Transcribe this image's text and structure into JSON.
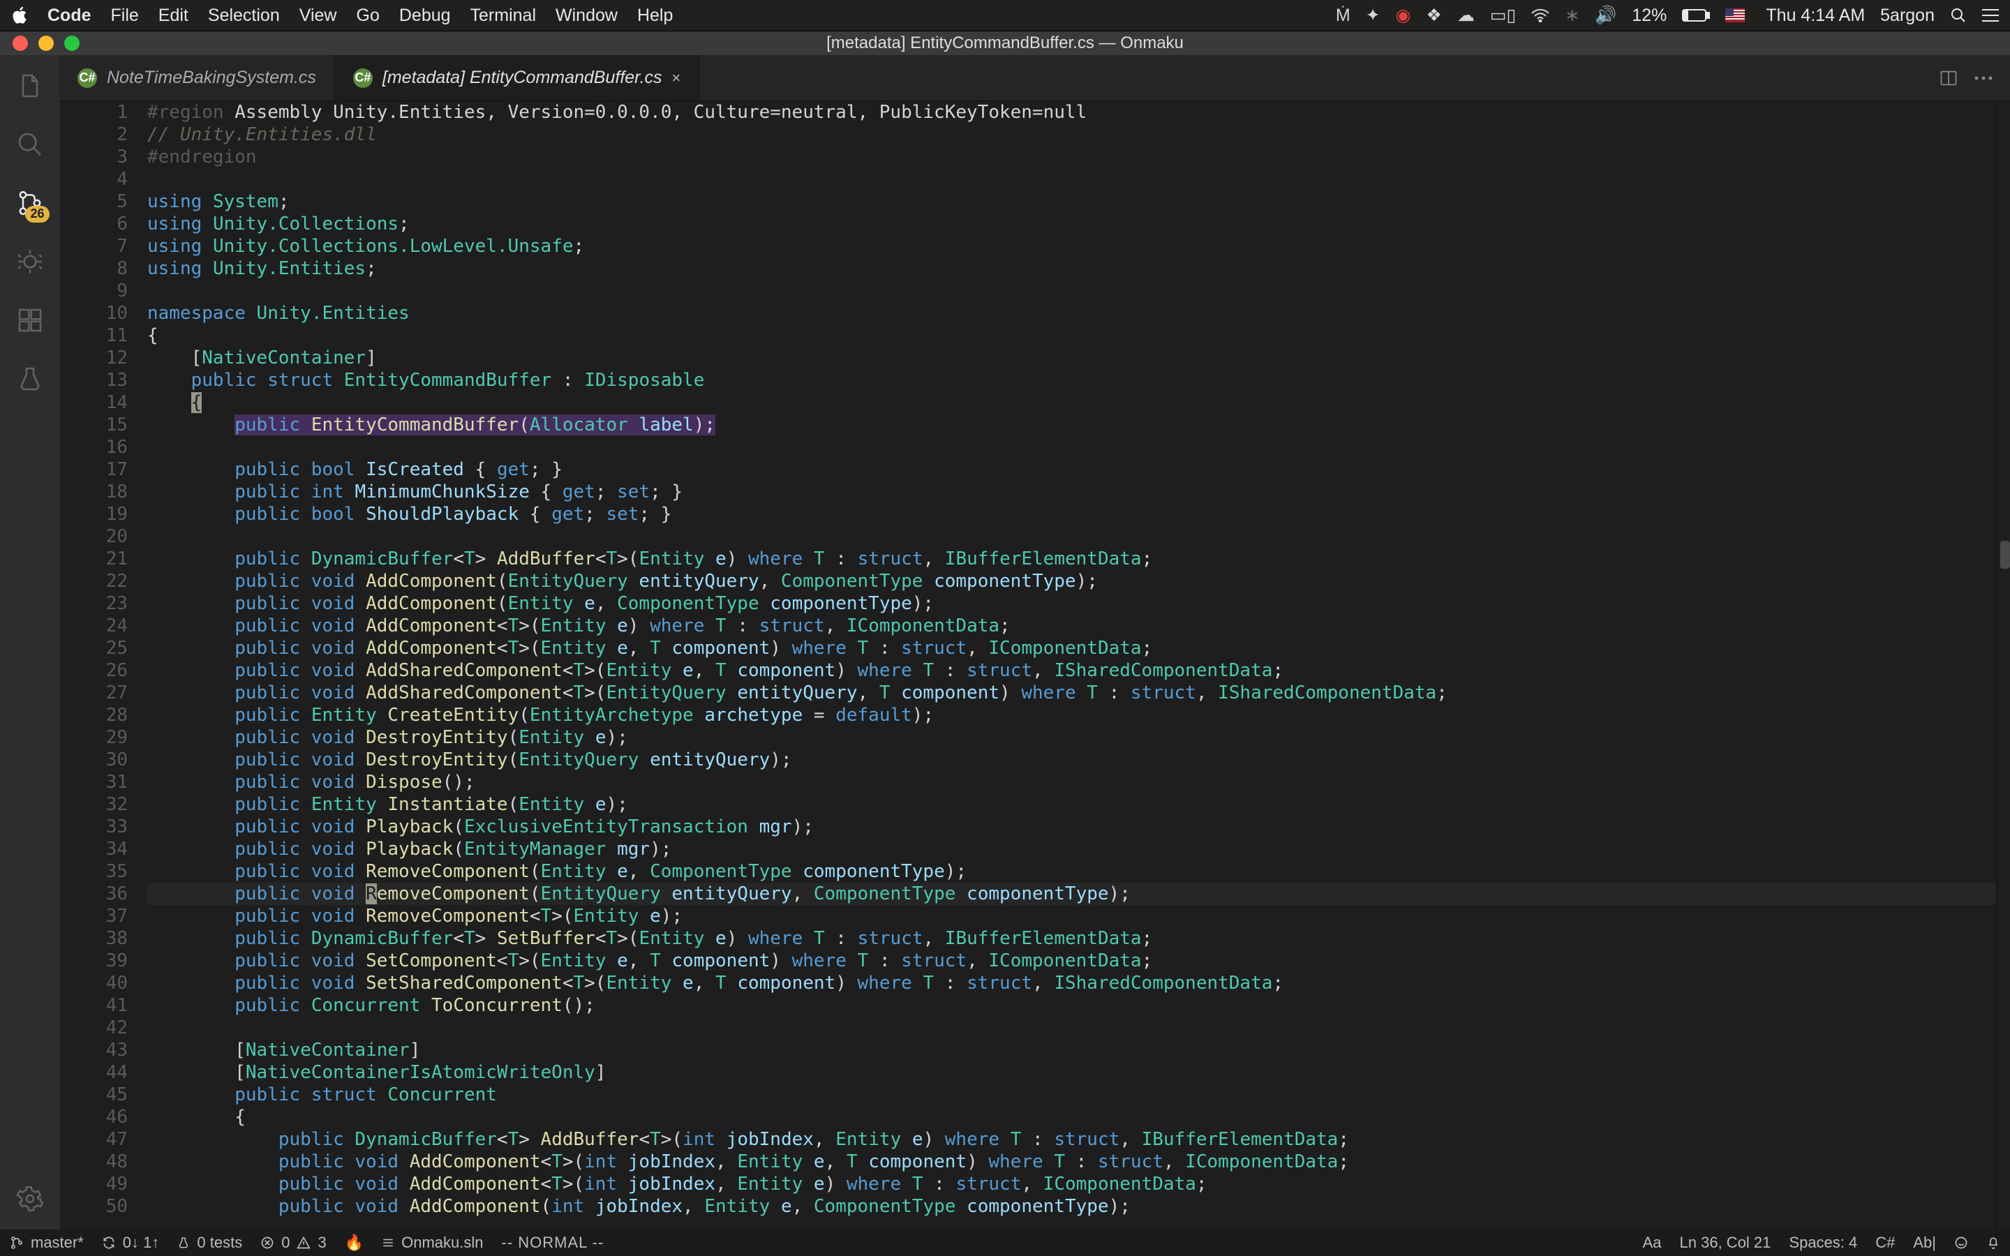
{
  "menubar": {
    "app_name": "Code",
    "items": [
      "File",
      "Edit",
      "Selection",
      "View",
      "Go",
      "Debug",
      "Terminal",
      "Window",
      "Help"
    ],
    "battery_pct": "12%",
    "clock": "Thu 4:14 AM",
    "user": "5argon"
  },
  "window": {
    "title": "[metadata] EntityCommandBuffer.cs — Onmaku"
  },
  "activitybar": {
    "badge": "26"
  },
  "tabs": [
    {
      "icon": "C#",
      "label": "NoteTimeBakingSystem.cs",
      "active": false,
      "close": false
    },
    {
      "icon": "C#",
      "label": "[metadata] EntityCommandBuffer.cs",
      "active": true,
      "close": true
    }
  ],
  "code": {
    "lines": [
      {
        "n": 1,
        "html": "<span class='kreg'>#region</span> <span class='pun'>Assembly Unity.Entities, Version=0.0.0.0, Culture=neutral, PublicKeyToken=null</span>"
      },
      {
        "n": 2,
        "html": "<span class='kcmt'>// Unity.Entities.dll</span>"
      },
      {
        "n": 3,
        "html": "<span class='kreg'>#endregion</span>"
      },
      {
        "n": 4,
        "html": ""
      },
      {
        "n": 5,
        "html": "<span class='kwd'>using</span> <span class='typ'>System</span>;"
      },
      {
        "n": 6,
        "html": "<span class='kwd'>using</span> <span class='typ'>Unity.Collections</span>;"
      },
      {
        "n": 7,
        "html": "<span class='kwd'>using</span> <span class='typ'>Unity.Collections.LowLevel.Unsafe</span>;"
      },
      {
        "n": 8,
        "html": "<span class='kwd'>using</span> <span class='typ'>Unity.Entities</span>;"
      },
      {
        "n": 9,
        "html": ""
      },
      {
        "n": 10,
        "html": "<span class='kwd'>namespace</span> <span class='typ'>Unity.Entities</span>"
      },
      {
        "n": 11,
        "html": "{"
      },
      {
        "n": 12,
        "html": "    [<span class='typ'>NativeContainer</span>]"
      },
      {
        "n": 13,
        "html": "    <span class='kwd'>public struct</span> <span class='typ'>EntityCommandBuffer</span> : <span class='typ'>IDisposable</span>"
      },
      {
        "n": 14,
        "html": "    <span class='cursorbox'>{</span>"
      },
      {
        "n": 15,
        "html": "        <span class='selbg'><span class='kwd'>public</span> <span class='fn'>EntityCommandBuffer</span>(<span class='typ'>Allocator</span> <span class='par'>label</span>);</span>"
      },
      {
        "n": 16,
        "html": ""
      },
      {
        "n": 17,
        "html": "        <span class='kwd'>public bool</span> <span class='par'>IsCreated</span> { <span class='kwd'>get</span>; }"
      },
      {
        "n": 18,
        "html": "        <span class='kwd'>public int</span> <span class='par'>MinimumChunkSize</span> { <span class='kwd'>get</span>; <span class='kwd'>set</span>; }"
      },
      {
        "n": 19,
        "html": "        <span class='kwd'>public bool</span> <span class='par'>ShouldPlayback</span> { <span class='kwd'>get</span>; <span class='kwd'>set</span>; }"
      },
      {
        "n": 20,
        "html": ""
      },
      {
        "n": 21,
        "html": "        <span class='kwd'>public</span> <span class='typ'>DynamicBuffer</span>&lt;<span class='typ'>T</span>&gt; <span class='fn'>AddBuffer</span>&lt;<span class='typ'>T</span>&gt;(<span class='typ'>Entity</span> <span class='par'>e</span>) <span class='kwd'>where</span> <span class='typ'>T</span> : <span class='kwd'>struct</span>, <span class='typ'>IBufferElementData</span>;"
      },
      {
        "n": 22,
        "html": "        <span class='kwd'>public void</span> <span class='fn'>AddComponent</span>(<span class='typ'>EntityQuery</span> <span class='par'>entityQuery</span>, <span class='typ'>ComponentType</span> <span class='par'>componentType</span>);"
      },
      {
        "n": 23,
        "html": "        <span class='kwd'>public void</span> <span class='fn'>AddComponent</span>(<span class='typ'>Entity</span> <span class='par'>e</span>, <span class='typ'>ComponentType</span> <span class='par'>componentType</span>);"
      },
      {
        "n": 24,
        "html": "        <span class='kwd'>public void</span> <span class='fn'>AddComponent</span>&lt;<span class='typ'>T</span>&gt;(<span class='typ'>Entity</span> <span class='par'>e</span>) <span class='kwd'>where</span> <span class='typ'>T</span> : <span class='kwd'>struct</span>, <span class='typ'>IComponentData</span>;"
      },
      {
        "n": 25,
        "html": "        <span class='kwd'>public void</span> <span class='fn'>AddComponent</span>&lt;<span class='typ'>T</span>&gt;(<span class='typ'>Entity</span> <span class='par'>e</span>, <span class='typ'>T</span> <span class='par'>component</span>) <span class='kwd'>where</span> <span class='typ'>T</span> : <span class='kwd'>struct</span>, <span class='typ'>IComponentData</span>;"
      },
      {
        "n": 26,
        "html": "        <span class='kwd'>public void</span> <span class='fn'>AddSharedComponent</span>&lt;<span class='typ'>T</span>&gt;(<span class='typ'>Entity</span> <span class='par'>e</span>, <span class='typ'>T</span> <span class='par'>component</span>) <span class='kwd'>where</span> <span class='typ'>T</span> : <span class='kwd'>struct</span>, <span class='typ'>ISharedComponentData</span>;"
      },
      {
        "n": 27,
        "html": "        <span class='kwd'>public void</span> <span class='fn'>AddSharedComponent</span>&lt;<span class='typ'>T</span>&gt;(<span class='typ'>EntityQuery</span> <span class='par'>entityQuery</span>, <span class='typ'>T</span> <span class='par'>component</span>) <span class='kwd'>where</span> <span class='typ'>T</span> : <span class='kwd'>struct</span>, <span class='typ'>ISharedComponentData</span>;"
      },
      {
        "n": 28,
        "html": "        <span class='kwd'>public</span> <span class='typ'>Entity</span> <span class='fn'>CreateEntity</span>(<span class='typ'>EntityArchetype</span> <span class='par'>archetype</span> = <span class='kwd'>default</span>);"
      },
      {
        "n": 29,
        "html": "        <span class='kwd'>public void</span> <span class='fn'>DestroyEntity</span>(<span class='typ'>Entity</span> <span class='par'>e</span>);"
      },
      {
        "n": 30,
        "html": "        <span class='kwd'>public void</span> <span class='fn'>DestroyEntity</span>(<span class='typ'>EntityQuery</span> <span class='par'>entityQuery</span>);"
      },
      {
        "n": 31,
        "html": "        <span class='kwd'>public void</span> <span class='fn'>Dispose</span>();"
      },
      {
        "n": 32,
        "html": "        <span class='kwd'>public</span> <span class='typ'>Entity</span> <span class='fn'>Instantiate</span>(<span class='typ'>Entity</span> <span class='par'>e</span>);"
      },
      {
        "n": 33,
        "html": "        <span class='kwd'>public void</span> <span class='fn'>Playback</span>(<span class='typ'>ExclusiveEntityTransaction</span> <span class='par'>mgr</span>);"
      },
      {
        "n": 34,
        "html": "        <span class='kwd'>public void</span> <span class='fn'>Playback</span>(<span class='typ'>EntityManager</span> <span class='par'>mgr</span>);"
      },
      {
        "n": 35,
        "html": "        <span class='kwd'>public void</span> <span class='fn'>RemoveComponent</span>(<span class='typ'>Entity</span> <span class='par'>e</span>, <span class='typ'>ComponentType</span> <span class='par'>componentType</span>);"
      },
      {
        "n": 36,
        "hl": true,
        "html": "        <span class='kwd'>public void</span> <span class='cursorbox'>R</span><span class='fn'>emoveComponent</span>(<span class='typ'>EntityQuery</span> <span class='par'>entityQuery</span>, <span class='typ'>ComponentType</span> <span class='par'>componentType</span>);"
      },
      {
        "n": 37,
        "html": "        <span class='kwd'>public void</span> <span class='fn'>RemoveComponent</span>&lt;<span class='typ'>T</span>&gt;(<span class='typ'>Entity</span> <span class='par'>e</span>);"
      },
      {
        "n": 38,
        "html": "        <span class='kwd'>public</span> <span class='typ'>DynamicBuffer</span>&lt;<span class='typ'>T</span>&gt; <span class='fn'>SetBuffer</span>&lt;<span class='typ'>T</span>&gt;(<span class='typ'>Entity</span> <span class='par'>e</span>) <span class='kwd'>where</span> <span class='typ'>T</span> : <span class='kwd'>struct</span>, <span class='typ'>IBufferElementData</span>;"
      },
      {
        "n": 39,
        "html": "        <span class='kwd'>public void</span> <span class='fn'>SetComponent</span>&lt;<span class='typ'>T</span>&gt;(<span class='typ'>Entity</span> <span class='par'>e</span>, <span class='typ'>T</span> <span class='par'>component</span>) <span class='kwd'>where</span> <span class='typ'>T</span> : <span class='kwd'>struct</span>, <span class='typ'>IComponentData</span>;"
      },
      {
        "n": 40,
        "html": "        <span class='kwd'>public void</span> <span class='fn'>SetSharedComponent</span>&lt;<span class='typ'>T</span>&gt;(<span class='typ'>Entity</span> <span class='par'>e</span>, <span class='typ'>T</span> <span class='par'>component</span>) <span class='kwd'>where</span> <span class='typ'>T</span> : <span class='kwd'>struct</span>, <span class='typ'>ISharedComponentData</span>;"
      },
      {
        "n": 41,
        "html": "        <span class='kwd'>public</span> <span class='typ'>Concurrent</span> <span class='fn'>ToConcurrent</span>();"
      },
      {
        "n": 42,
        "html": ""
      },
      {
        "n": 43,
        "html": "        [<span class='typ'>NativeContainer</span>]"
      },
      {
        "n": 44,
        "html": "        [<span class='typ'>NativeContainerIsAtomicWriteOnly</span>]"
      },
      {
        "n": 45,
        "html": "        <span class='kwd'>public struct</span> <span class='typ'>Concurrent</span>"
      },
      {
        "n": 46,
        "html": "        {"
      },
      {
        "n": 47,
        "html": "            <span class='kwd'>public</span> <span class='typ'>DynamicBuffer</span>&lt;<span class='typ'>T</span>&gt; <span class='fn'>AddBuffer</span>&lt;<span class='typ'>T</span>&gt;(<span class='kwd'>int</span> <span class='par'>jobIndex</span>, <span class='typ'>Entity</span> <span class='par'>e</span>) <span class='kwd'>where</span> <span class='typ'>T</span> : <span class='kwd'>struct</span>, <span class='typ'>IBufferElementData</span>;"
      },
      {
        "n": 48,
        "html": "            <span class='kwd'>public void</span> <span class='fn'>AddComponent</span>&lt;<span class='typ'>T</span>&gt;(<span class='kwd'>int</span> <span class='par'>jobIndex</span>, <span class='typ'>Entity</span> <span class='par'>e</span>, <span class='typ'>T</span> <span class='par'>component</span>) <span class='kwd'>where</span> <span class='typ'>T</span> : <span class='kwd'>struct</span>, <span class='typ'>IComponentData</span>;"
      },
      {
        "n": 49,
        "html": "            <span class='kwd'>public void</span> <span class='fn'>AddComponent</span>&lt;<span class='typ'>T</span>&gt;(<span class='kwd'>int</span> <span class='par'>jobIndex</span>, <span class='typ'>Entity</span> <span class='par'>e</span>) <span class='kwd'>where</span> <span class='typ'>T</span> : <span class='kwd'>struct</span>, <span class='typ'>IComponentData</span>;"
      },
      {
        "n": 50,
        "html": "            <span class='kwd'>public void</span> <span class='fn'>AddComponent</span>(<span class='kwd'>int</span> <span class='par'>jobIndex</span>, <span class='typ'>Entity</span> <span class='par'>e</span>, <span class='typ'>ComponentType</span> <span class='par'>componentType</span>);"
      }
    ]
  },
  "status": {
    "branch": "master*",
    "sync": "0↓ 1↑",
    "tests": "0 tests",
    "errors": "0",
    "warnings": "3",
    "sln": "Onmaku.sln",
    "vim": "-- NORMAL --",
    "case": "Aa",
    "pos": "Ln 36, Col 21",
    "spaces": "Spaces: 4",
    "lang": "C#",
    "ab": "Ab|"
  }
}
